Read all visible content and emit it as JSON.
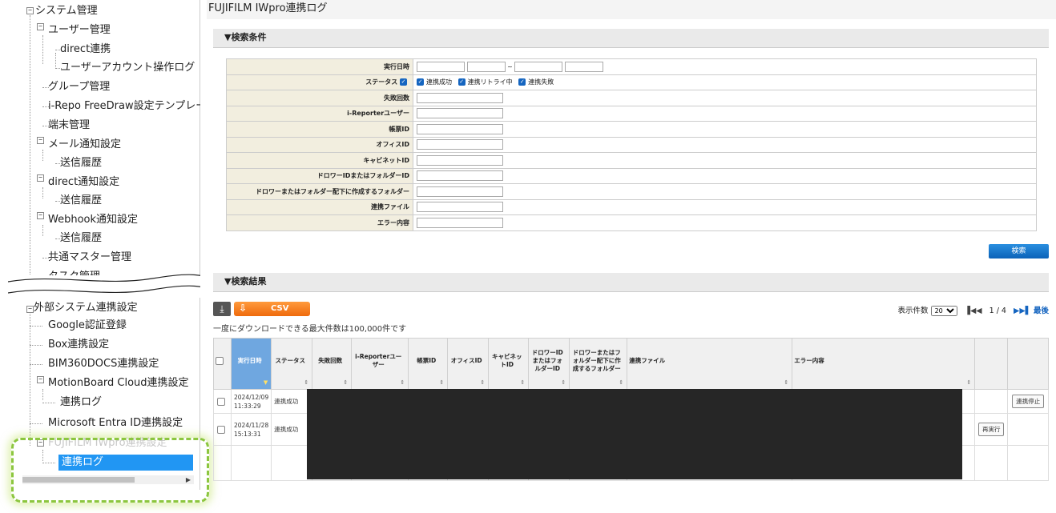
{
  "tree": {
    "items": [
      {
        "label": "システム管理"
      },
      {
        "label": "ユーザー管理"
      },
      {
        "label": "direct連携"
      },
      {
        "label": "ユーザーアカウント操作ログ"
      },
      {
        "label": "グループ管理"
      },
      {
        "label": "i-Repo FreeDraw設定テンプレー"
      },
      {
        "label": "端末管理"
      },
      {
        "label": "メール通知設定"
      },
      {
        "label": "送信履歴"
      },
      {
        "label": "direct通知設定"
      },
      {
        "label": "送信履歴"
      },
      {
        "label": "Webhook通知設定"
      },
      {
        "label": "送信履歴"
      },
      {
        "label": "共通マスター管理"
      },
      {
        "label": "タスク管理"
      },
      {
        "label": "外部システム連携設定"
      },
      {
        "label": "Google認証登録"
      },
      {
        "label": "Box連携設定"
      },
      {
        "label": "BIM360DOCS連携設定"
      },
      {
        "label": "MotionBoard Cloud連携設定"
      },
      {
        "label": "連携ログ"
      },
      {
        "label": "Microsoft Entra ID連携設定"
      },
      {
        "label": "FUJIFILM IWpro連携設定"
      },
      {
        "label": "連携ログ"
      }
    ],
    "selected_index": 23
  },
  "main": {
    "title": "FUJIFILM IWpro連携ログ",
    "search_header": "▼検索条件",
    "results_header": "▼検索結果",
    "conditions": {
      "exec_date": "実行日時",
      "tilde": "~",
      "status": "ステータス",
      "status_options": [
        "連携成功",
        "連携リトライ中",
        "連携失敗"
      ],
      "failures": "失敗回数",
      "user": "i-Reporterユーザー",
      "sheet_id": "帳票ID",
      "office_id": "オフィスID",
      "cabinet_id": "キャビネットID",
      "drawer_id": "ドロワーIDまたはフォルダーID",
      "drawer_folder": "ドロワーまたはフォルダー配下に作成するフォルダー",
      "file": "連携ファイル",
      "error": "エラー内容"
    },
    "search_button": "検索",
    "csv_label": "CSV",
    "max_note": "一度にダウンロードできる最大件数は100,000件です",
    "pager": {
      "count_label": "表示件数",
      "count_value": "20",
      "first": "▐◀◀",
      "page": "1 / 4",
      "next": "▶▶▌",
      "last": "最後"
    },
    "columns": [
      "実行日時",
      "ステータス",
      "失敗回数",
      "i-Reporterユーザー",
      "帳票ID",
      "オフィスID",
      "キャビネットID",
      "ドロワーIDまたはフォルダーID",
      "ドロワーまたはフォルダー配下に作成するフォルダー",
      "連携ファイル",
      "エラー内容"
    ],
    "rows": [
      {
        "date": "2024/12/09",
        "time": "11:33:29",
        "status": "連携成功",
        "action": "連携停止"
      },
      {
        "date": "2024/11/28",
        "time": "15:13:31",
        "status": "連携成功",
        "action": "再実行"
      }
    ]
  },
  "colors": {
    "selected": "#2196f3",
    "search_button": "#0b62b8",
    "csv_button": "#ef6a0c",
    "highlight": "#8cc63f"
  }
}
